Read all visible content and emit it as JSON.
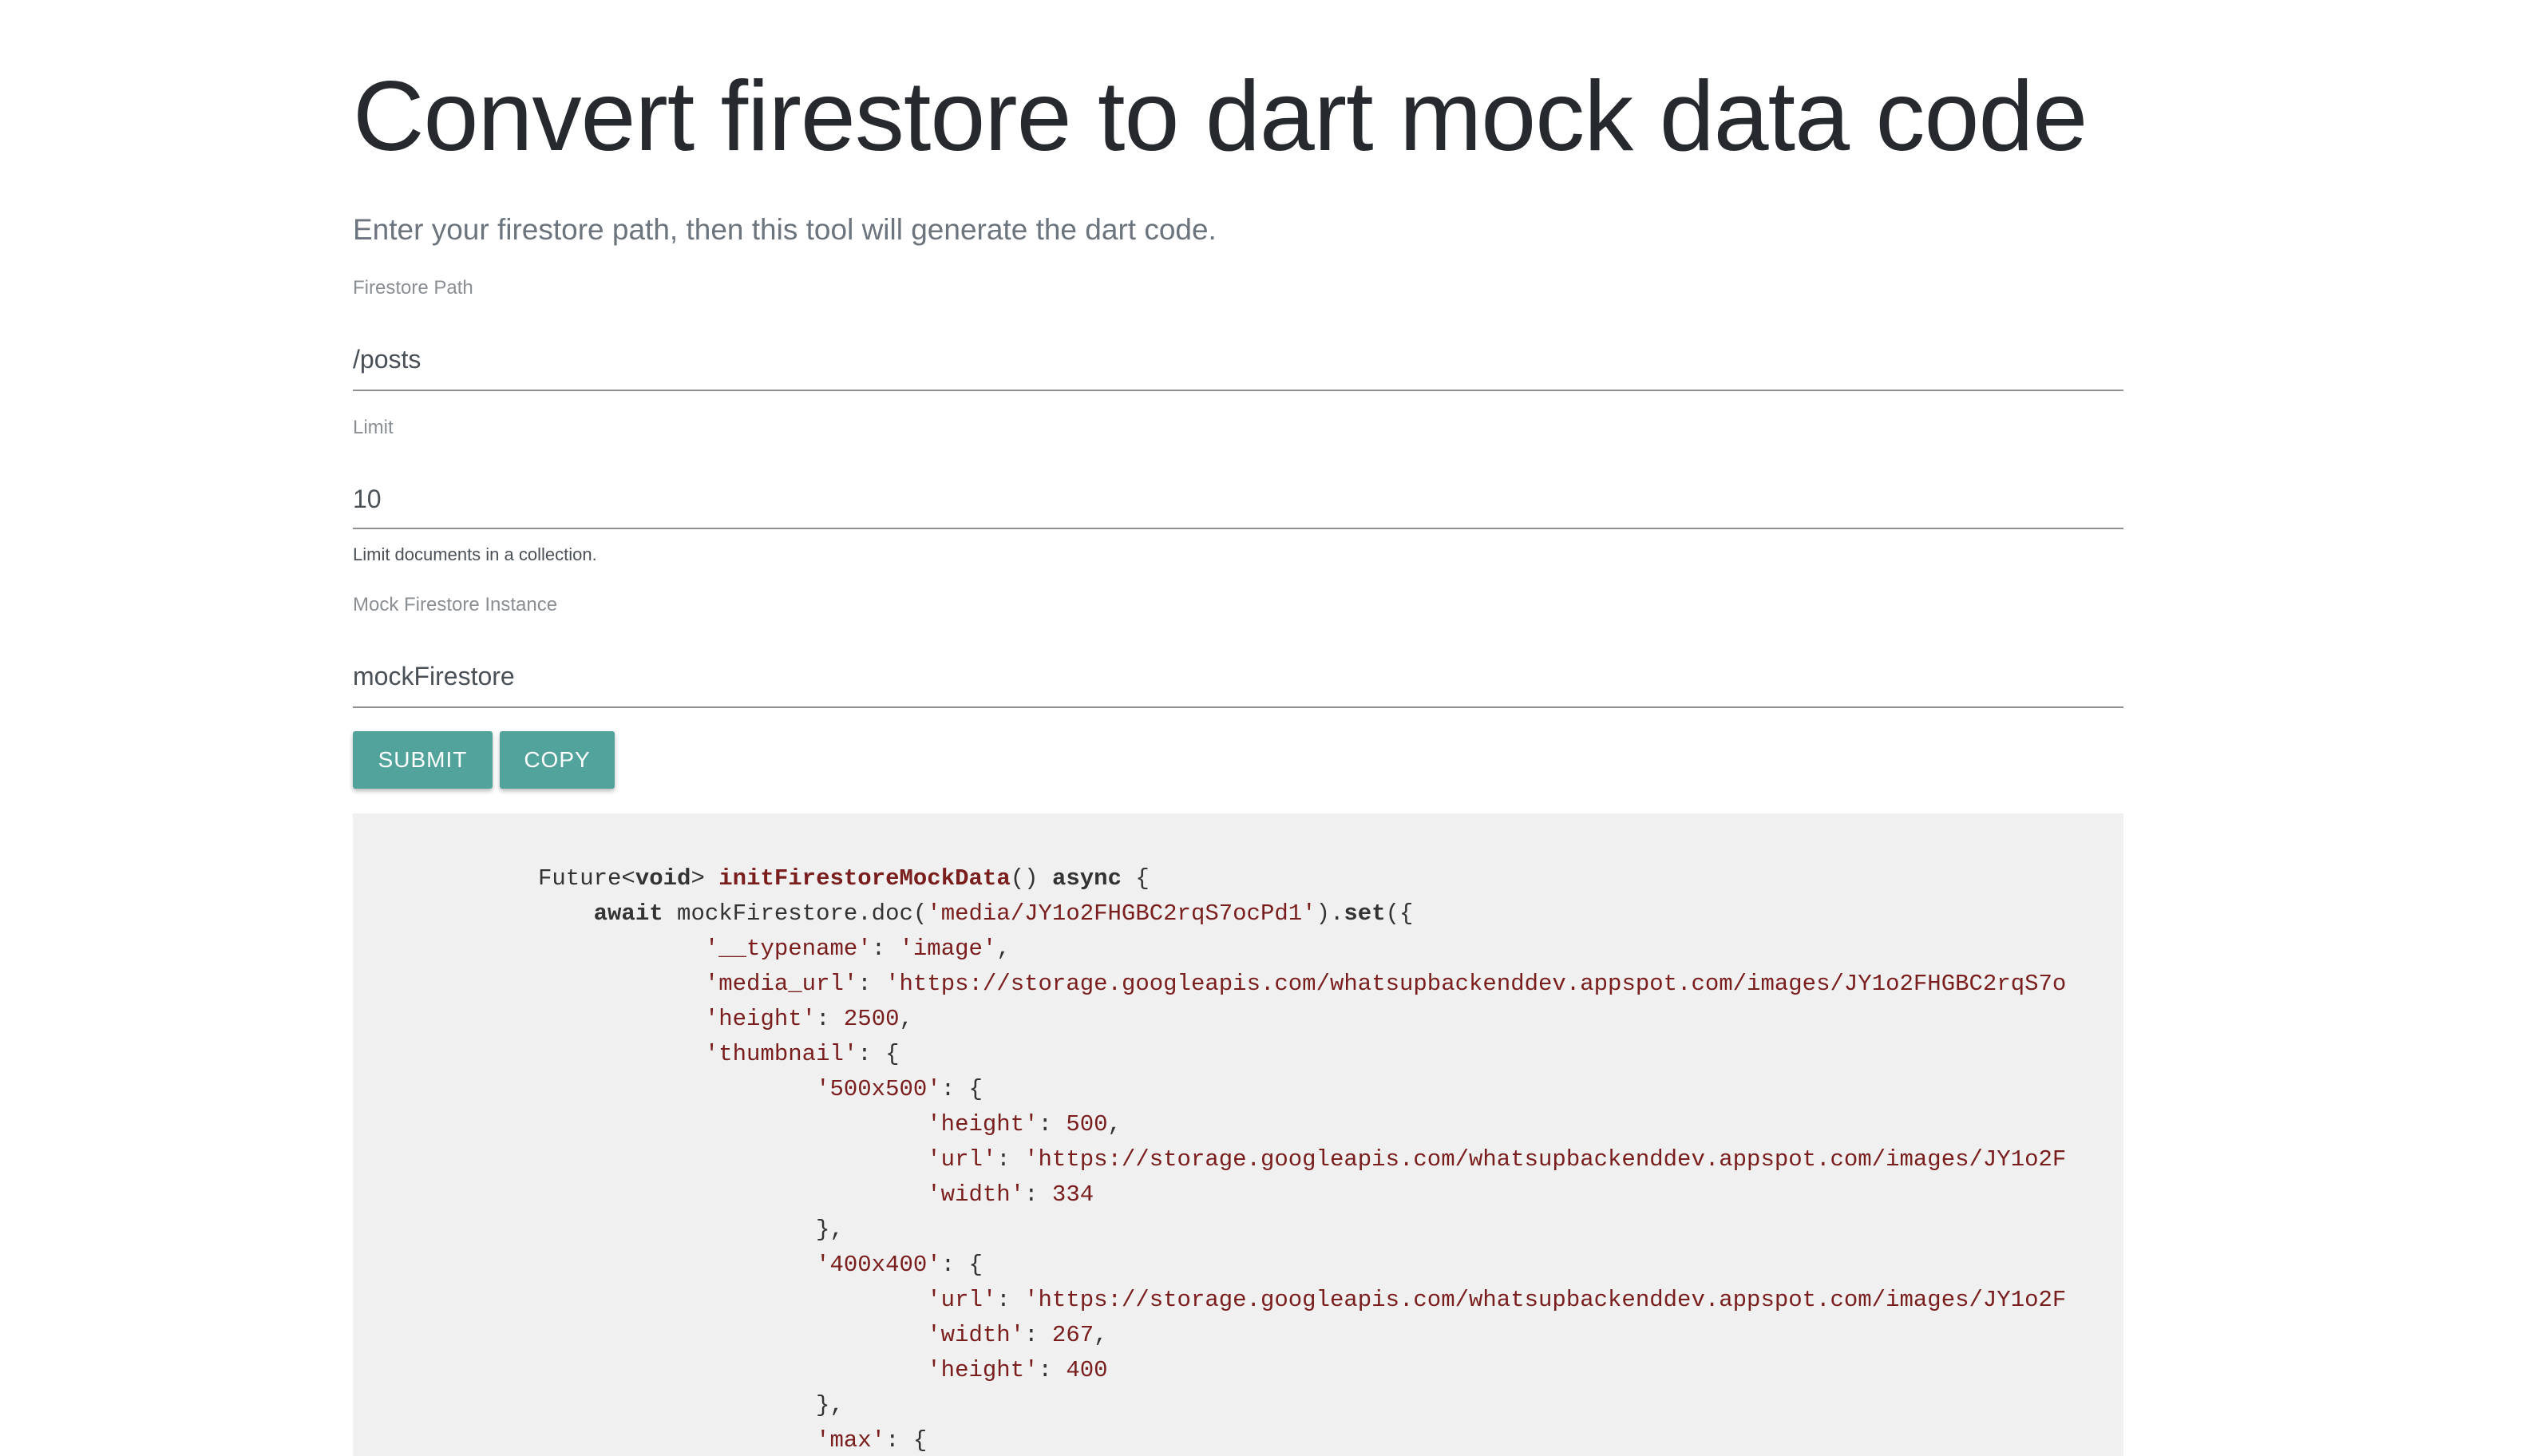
{
  "page": {
    "title": "Convert firestore to dart mock data code",
    "lead": "Enter your firestore path, then this tool will generate the dart code."
  },
  "form": {
    "path": {
      "label": "Firestore Path",
      "value": "/posts"
    },
    "limit": {
      "label": "Limit",
      "value": "10",
      "help": "Limit documents in a collection."
    },
    "instance": {
      "label": "Mock Firestore Instance",
      "value": "mockFirestore"
    }
  },
  "buttons": {
    "submit": "SUBMIT",
    "copy": "COPY"
  },
  "colors": {
    "button": "#52a39b",
    "code_bg": "#f0f0f0",
    "code_string": "#7a1d1d"
  },
  "code": {
    "l1": {
      "type": "Future<",
      "void": "void",
      "gt": "> ",
      "fn": "initFirestoreMockData",
      "paren": "() ",
      "async": "async",
      "brace": " {"
    },
    "l2": {
      "indent": "    ",
      "await": "await",
      "mid": " mockFirestore.doc(",
      "str": "'media/JY1o2FHGBC2rqS7ocPd1'",
      "close": ").",
      "set": "set",
      "end": "({"
    },
    "l3": {
      "indent": "            ",
      "key": "'__typename'",
      "sep": ": ",
      "val": "'image'",
      "end": ","
    },
    "l4": {
      "indent": "            ",
      "key": "'media_url'",
      "sep": ": ",
      "val": "'https://storage.googleapis.com/whatsupbackenddev.appspot.com/images/JY1o2FHGBC2rqS7o"
    },
    "l5": {
      "indent": "            ",
      "key": "'height'",
      "sep": ": ",
      "val": "2500",
      "end": ","
    },
    "l6": {
      "indent": "            ",
      "key": "'thumbnail'",
      "end": ": {"
    },
    "l7": {
      "indent": "                    ",
      "key": "'500x500'",
      "end": ": {"
    },
    "l8": {
      "indent": "                            ",
      "key": "'height'",
      "sep": ": ",
      "val": "500",
      "end": ","
    },
    "l9": {
      "indent": "                            ",
      "key": "'url'",
      "sep": ": ",
      "val": "'https://storage.googleapis.com/whatsupbackenddev.appspot.com/images/JY1o2F"
    },
    "l10": {
      "indent": "                            ",
      "key": "'width'",
      "sep": ": ",
      "val": "334"
    },
    "l11": {
      "text": "                    },"
    },
    "l12": {
      "indent": "                    ",
      "key": "'400x400'",
      "end": ": {"
    },
    "l13": {
      "indent": "                            ",
      "key": "'url'",
      "sep": ": ",
      "val": "'https://storage.googleapis.com/whatsupbackenddev.appspot.com/images/JY1o2F"
    },
    "l14": {
      "indent": "                            ",
      "key": "'width'",
      "sep": ": ",
      "val": "267",
      "end": ","
    },
    "l15": {
      "indent": "                            ",
      "key": "'height'",
      "sep": ": ",
      "val": "400"
    },
    "l16": {
      "text": "                    },"
    },
    "l17": {
      "indent": "                    ",
      "key": "'max'",
      "end": ": {"
    }
  }
}
